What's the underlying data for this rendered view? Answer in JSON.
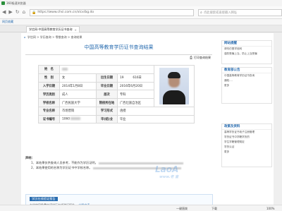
{
  "window": {
    "title": "360极速浏览器"
  },
  "toolbar": {
    "url": "https://www.chsi.com.cn/xlcx/bg.do",
    "search_placeholder": "点此搜索或直接输入网址",
    "back": "◀",
    "forward": "▶",
    "reload": "↻",
    "home": "⌂"
  },
  "bookmarks": {
    "label": "网页收藏"
  },
  "tab": {
    "label": "学信网-中国高等教育学历证书查询",
    "close": "×"
  },
  "breadcrumb": {
    "home": "⌂",
    "text": "学信网 > 学历查询 > 零散查询 > 查询结果"
  },
  "page": {
    "title": "中国高等教育学历证书查询结果",
    "print_label": "打印查询结果"
  },
  "cert": {
    "labels": {
      "name": "姓　名",
      "gender": "性　别",
      "birth": "出生日期",
      "enroll": "入学日期",
      "graduate": "毕业日期",
      "category": "学历类别",
      "level": "层次",
      "school": "学校名称",
      "school_loc": "院校所在地",
      "major": "专业名称",
      "form": "学习形式",
      "cert_no": "证书编号",
      "result": "毕(结)业"
    },
    "values": {
      "gender": "女",
      "birth": "19　　　616日",
      "enroll": "2014年1月8日",
      "graduate": "2016年6月20日",
      "category": "成人",
      "level": "专科",
      "school": "广西民族大学",
      "school_loc": "广西壮族自治区",
      "major": "市场营销",
      "form": "函授",
      "cert_no": "1060",
      "result": "毕业"
    }
  },
  "notes": {
    "heading": "声明：",
    "p1": "1、本结果仅供查询人员参考，不能作为学历证明。",
    "p2": "2、本结果使用的名称为学历证书中学校名称。"
  },
  "certification": {
    "button": "学历在线验证报告",
    "body": "在学信网免费申请学历在线验证报告，",
    "link": "立即申请"
  },
  "watermark": {
    "main": "LaoA",
    "sub": "www.老 查"
  },
  "sidebar": {
    "box1": {
      "title": "网站提醒",
      "lines": [
        "请勿仿冒学信网",
        "谨防受骗上当，防止上当受骗"
      ]
    },
    "box2": {
      "title": "教育部公告",
      "lines": [
        "中国高等教育学历证书查询",
        "通知....",
        "更多"
      ]
    },
    "box3": {
      "title": "政策及资料",
      "lines": [
        "高等学历证书电子注册管理",
        "学历证书中学籍学历的",
        "学生学籍管理规定",
        "学历认证",
        "更多"
      ]
    }
  },
  "status": {
    "left": "一键直拨",
    "mid": "下载",
    "right": "100%"
  }
}
